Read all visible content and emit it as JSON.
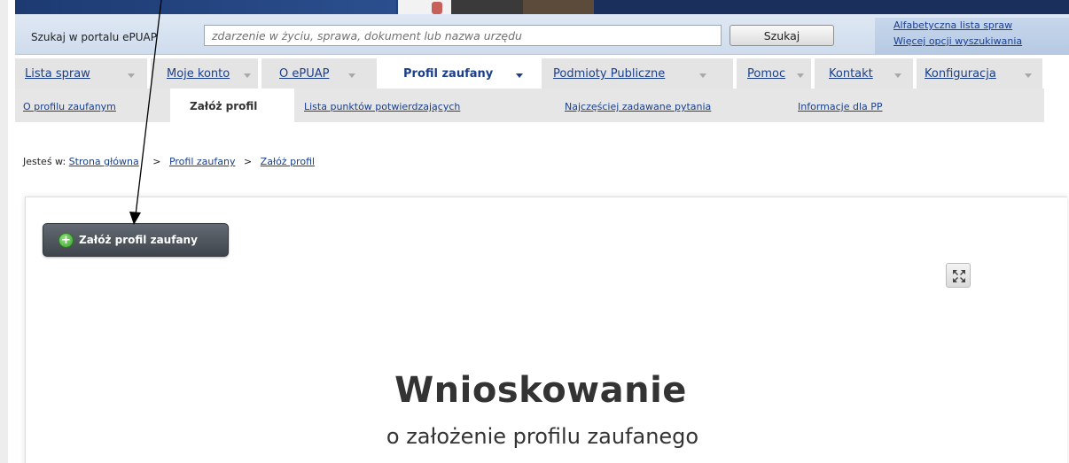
{
  "search": {
    "label": "Szukaj w portalu ePUAP",
    "placeholder": "zdarzenie w życiu, sprawa, dokument lub nazwa urzędu",
    "button": "Szukaj",
    "link_alphabetical": "Alfabetyczna lista spraw",
    "link_more_options": "Więcej opcji wyszukiwania"
  },
  "mainnav": {
    "tabs": [
      {
        "label": "Lista spraw"
      },
      {
        "label": "Moje konto"
      },
      {
        "label": "O ePUAP"
      },
      {
        "label": "Profil zaufany",
        "active": true
      },
      {
        "label": "Podmioty Publiczne"
      },
      {
        "label": "Pomoc"
      },
      {
        "label": "Kontakt"
      },
      {
        "label": "Konfiguracja"
      }
    ]
  },
  "subnav": {
    "items": [
      {
        "label": "O profilu zaufanym"
      },
      {
        "label": "Załóż profil",
        "active": true
      },
      {
        "label": "Lista punktów potwierdzających"
      },
      {
        "label": "Najczęściej zadawane pytania"
      },
      {
        "label": "Informacje dla PP"
      }
    ]
  },
  "breadcrumb": {
    "prefix": "Jesteś w:",
    "items": [
      "Strona główna",
      "Profil zaufany",
      "Załóż profil"
    ],
    "separator": ">"
  },
  "content": {
    "create_button": "Załóż profil zaufany",
    "title": "Wnioskowanie",
    "subtitle": "o założenie profilu zaufanego"
  },
  "icons": {
    "create_button_icon": "plus-circle-icon",
    "expand_icon": "fullscreen-expand-icon"
  },
  "colors": {
    "link": "#1b3f8b",
    "banner": "#223f78",
    "button_dark": "#4a5058",
    "plus_green": "#3ca52c"
  }
}
